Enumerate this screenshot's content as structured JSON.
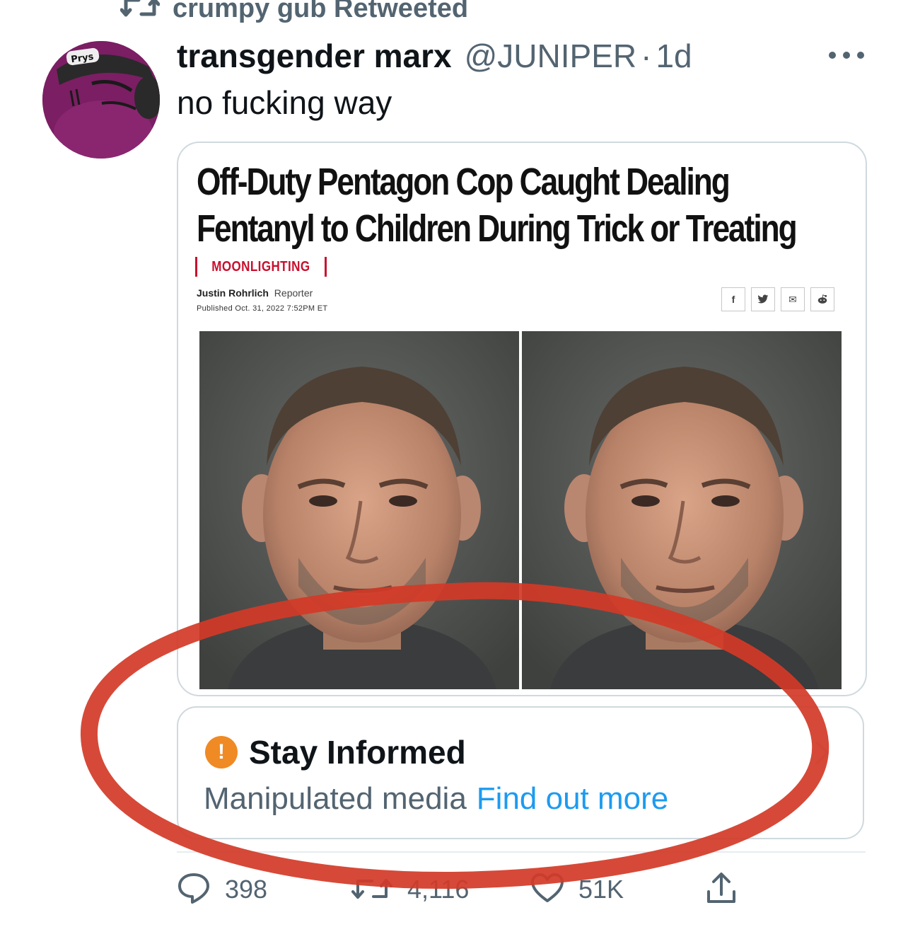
{
  "retweet_banner": {
    "text": "crumpy gub Retweeted"
  },
  "tweet": {
    "display_name": "transgender marx",
    "handle": "@JUNIPER",
    "separator": "·",
    "time": "1d",
    "text": "no fucking way",
    "avatar": {
      "cap_text": "Prys"
    }
  },
  "media": {
    "headline_line1": "Off-Duty Pentagon Cop Caught Dealing",
    "headline_line2": "Fentanyl to Children During Trick or Treating",
    "kicker": "MOONLIGHTING",
    "author": "Justin Rohrlich",
    "author_role": "Reporter",
    "published": "Published Oct. 31, 2022 7:52PM ET",
    "share_buttons": [
      {
        "glyph": "f",
        "icon": "facebook-icon"
      },
      {
        "glyph": "𝕪",
        "icon": "twitter-icon"
      },
      {
        "glyph": "✉",
        "icon": "email-icon"
      },
      {
        "glyph": "●",
        "icon": "reddit-icon"
      }
    ]
  },
  "notice": {
    "title": "Stay Informed",
    "description": "Manipulated media",
    "link": "Find out more",
    "icon": "warning-icon"
  },
  "actions": {
    "replies": "398",
    "retweets": "4,116",
    "likes": "51K"
  },
  "colors": {
    "text_primary": "#0f1419",
    "text_secondary": "#536471",
    "link": "#1d9bf0",
    "border": "#cfd9de",
    "warning": "#f08a24",
    "kicker_red": "#c8102e",
    "annotation_red": "#d23a27"
  }
}
